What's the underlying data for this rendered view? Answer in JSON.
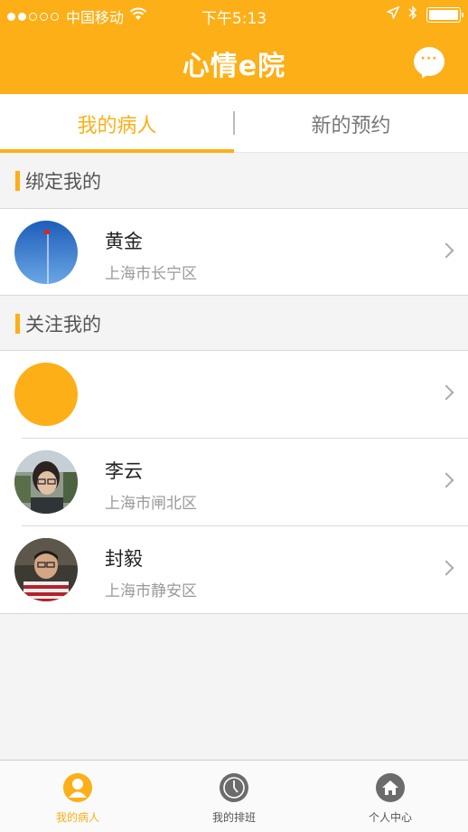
{
  "status_bar": {
    "carrier": "中国移动",
    "time": "下午5:13"
  },
  "header": {
    "logo_text": "心情e院",
    "chat_icon": "chat-bubble-icon"
  },
  "tabs": [
    {
      "label": "我的病人",
      "active": true
    },
    {
      "label": "新的预约",
      "active": false
    }
  ],
  "sections": {
    "bound": {
      "title": "绑定我的",
      "patients": [
        {
          "name": "黄金",
          "location": "上海市长宁区",
          "avatar": "flag-sky-avatar"
        }
      ]
    },
    "followers": {
      "title": "关注我的",
      "patients": [
        {
          "name": "",
          "location": "",
          "avatar": "orange-placeholder-avatar"
        },
        {
          "name": "李云",
          "location": "上海市闸北区",
          "avatar": "woman-glasses-avatar"
        },
        {
          "name": "封毅",
          "location": "上海市静安区",
          "avatar": "man-striped-shirt-avatar"
        }
      ]
    }
  },
  "tabbar": [
    {
      "label": "我的病人",
      "icon": "person-icon",
      "active": true
    },
    {
      "label": "我的排班",
      "icon": "clock-icon",
      "active": false
    },
    {
      "label": "个人中心",
      "icon": "home-icon",
      "active": false
    }
  ],
  "colors": {
    "accent": "#fdaf17",
    "background": "#f4f4f4",
    "inactive_icon": "#6b6b6b"
  }
}
